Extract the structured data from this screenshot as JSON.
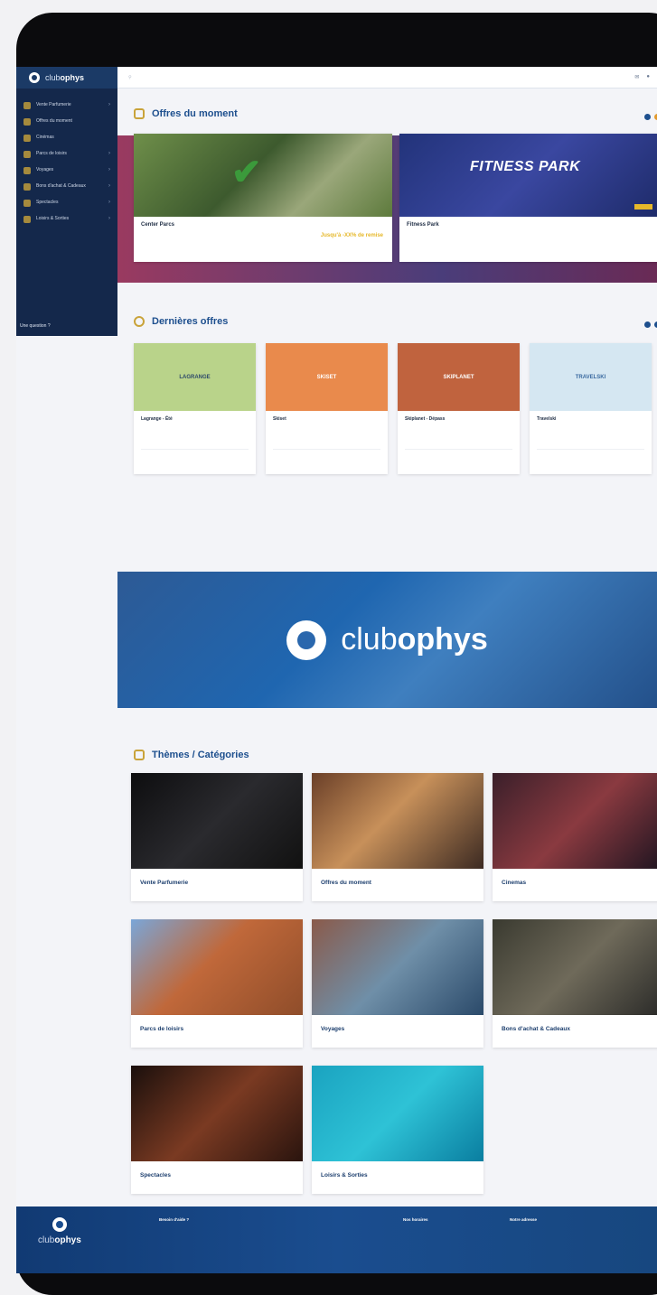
{
  "app": {
    "brand_light": "club",
    "brand_bold": "ophys"
  },
  "sidebar": {
    "items": [
      {
        "label": "Vente Parfumerie"
      },
      {
        "label": "Offres du moment"
      },
      {
        "label": "Cinémas"
      },
      {
        "label": "Parcs de loisirs"
      },
      {
        "label": "Voyages"
      },
      {
        "label": "Bons d'achat & Cadeaux"
      },
      {
        "label": "Spectacles"
      },
      {
        "label": "Loisirs & Sorties"
      }
    ],
    "help_title": "Une question ?",
    "help_sub": ""
  },
  "header": {
    "search_placeholder": ""
  },
  "moment": {
    "title": "Offres du moment",
    "cards": [
      {
        "name": "Center Parcs",
        "desc": "",
        "price": "Jusqu'à -XX% de remise"
      },
      {
        "name": "Fitness Park",
        "desc": "",
        "badge": "",
        "price": "",
        "image_text": "FITNESS PARK"
      }
    ]
  },
  "latest": {
    "title": "Dernières offres",
    "cards": [
      {
        "name": "Lagrange - Été",
        "logo": "LAGRANGE",
        "desc": "",
        "price": "",
        "bg": "#b9d38a"
      },
      {
        "name": "Skiset",
        "logo": "SKISET",
        "desc": "",
        "price": "",
        "bg": "#e98a4c"
      },
      {
        "name": "Skiplanet - Dépass",
        "logo": "SKIPLANET",
        "desc": "",
        "price": "",
        "bg": "#c0633e"
      },
      {
        "name": "Travelski",
        "logo": "TRAVELSKI",
        "desc": "",
        "price": "",
        "bg": "#d5e7f2"
      }
    ]
  },
  "banner": {
    "light": "club",
    "bold": "ophys"
  },
  "themes": {
    "title": "Thèmes / Catégories",
    "items": [
      {
        "label": "Vente Parfumerie",
        "grad": "linear-gradient(135deg,#0d0d0f,#2a2a2e 50%,#111)"
      },
      {
        "label": "Offres du moment",
        "grad": "linear-gradient(135deg,#6a3f28,#c7905a 45%,#3c2a22)"
      },
      {
        "label": "Cinemas",
        "grad": "linear-gradient(135deg,#3a1f2a,#8a3a40 50%,#1e1420)"
      },
      {
        "label": "Parcs de loisirs",
        "grad": "linear-gradient(135deg,#7aa6d8,#c0683a 45%,#8f4d2a)"
      },
      {
        "label": "Voyages",
        "grad": "linear-gradient(135deg,#8a5a4a,#6f8fa8 50%,#2b4a6a)"
      },
      {
        "label": "Bons d'achat & Cadeaux",
        "grad": "linear-gradient(135deg,#3a3a30,#6f6a5a 50%,#2a2a28)"
      },
      {
        "label": "Spectacles",
        "grad": "linear-gradient(135deg,#1a0f0c,#7a3a22 50%,#2a140e)"
      },
      {
        "label": "Loisirs & Sorties",
        "grad": "linear-gradient(135deg,#1aa3c0,#2ec2d6 50%,#0a7ea0)"
      }
    ]
  },
  "footer": {
    "col1_title": "Besoin d'aide ?",
    "col1_val": "",
    "col2_title": "Nos horaires",
    "col2_val": "",
    "col3_title": "Notre adresse",
    "col3_val": ""
  },
  "colors": {
    "primary": "#14284b",
    "accent": "#e6b82a",
    "title_blue": "#1d4f8e"
  }
}
